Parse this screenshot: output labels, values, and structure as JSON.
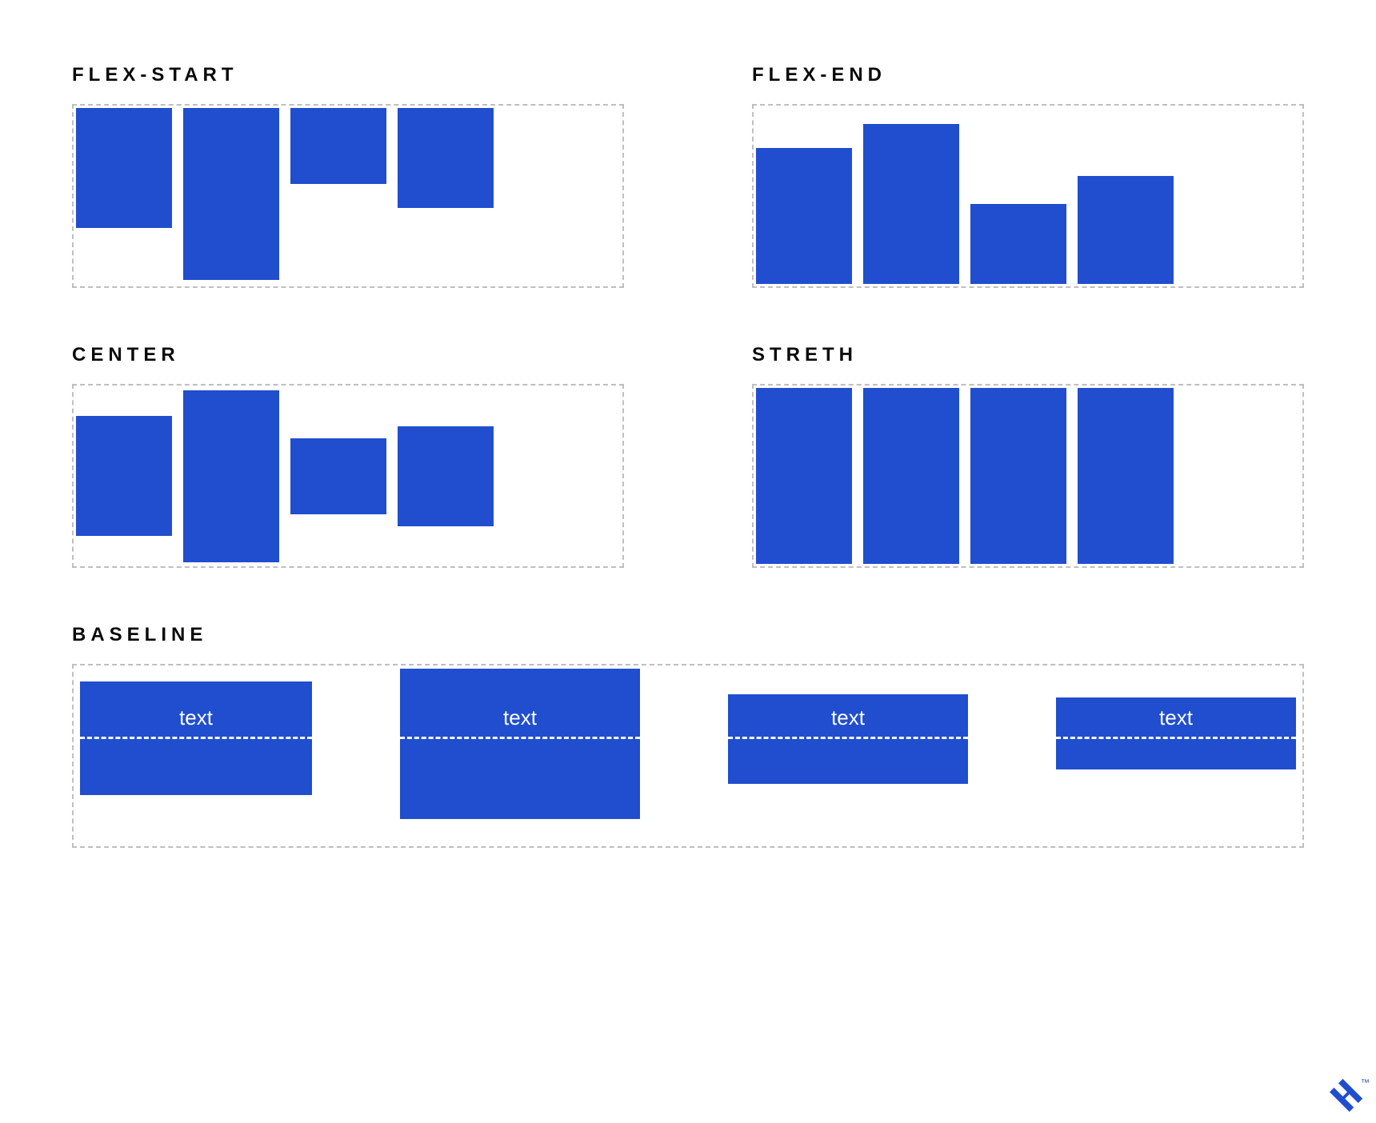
{
  "titles": {
    "flex_start": "FLEX-START",
    "flex_end": "FLEX-END",
    "center": "CENTER",
    "stretch": "STRETH",
    "baseline": "BASELINE"
  },
  "baseline": {
    "items": [
      {
        "label": "text"
      },
      {
        "label": "text"
      },
      {
        "label": "text"
      },
      {
        "label": "text"
      }
    ]
  },
  "colors": {
    "box": "#204ecf",
    "border": "#bfbfbf",
    "text": "#0a0a0a"
  },
  "chart_data": {
    "type": "diagram",
    "title": "CSS Flexbox align-items values",
    "panels": [
      {
        "name": "flex-start",
        "boxes_relative_height": [
          0.65,
          0.95,
          0.42,
          0.55
        ],
        "align": "top"
      },
      {
        "name": "flex-end",
        "boxes_relative_height": [
          0.74,
          0.87,
          0.44,
          0.59
        ],
        "align": "bottom"
      },
      {
        "name": "center",
        "boxes_relative_height": [
          0.65,
          0.95,
          0.42,
          0.55
        ],
        "align": "middle"
      },
      {
        "name": "stretch",
        "boxes_relative_height": [
          1,
          1,
          1,
          1
        ],
        "align": "stretch"
      },
      {
        "name": "baseline",
        "boxes": 4,
        "text": "text",
        "align": "text-baseline"
      }
    ]
  },
  "logo": {
    "trademark": "™"
  }
}
